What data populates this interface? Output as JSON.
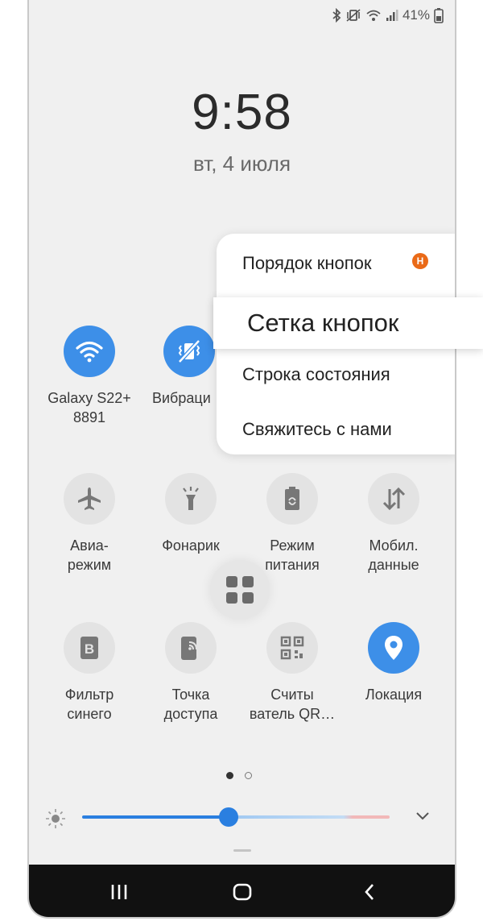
{
  "status_bar": {
    "battery_percent": "41%",
    "icons": [
      "bluetooth-icon",
      "vibrate-icon",
      "wifi-icon",
      "signal-icon",
      "battery-icon"
    ]
  },
  "lockscreen": {
    "time": "9:58",
    "date": "вт, 4 июля"
  },
  "quick_panel": {
    "row1": [
      {
        "label": "Galaxy S22+\n8891",
        "icon": "wifi-icon",
        "active": true
      },
      {
        "label": "Вибраци",
        "icon": "vibrate-icon",
        "active": true
      }
    ],
    "row2": [
      {
        "label": "Авиа-\nрежим",
        "icon": "airplane-icon",
        "active": false
      },
      {
        "label": "Фонарик",
        "icon": "flashlight-icon",
        "active": false
      },
      {
        "label": "Режим\nпитания",
        "icon": "battery-saver-icon",
        "active": false
      },
      {
        "label": "Мобил.\nданные",
        "icon": "mobile-data-icon",
        "active": false
      }
    ],
    "row3": [
      {
        "label": "Фильтр\nсинего",
        "icon": "blue-light-filter-icon",
        "active": false
      },
      {
        "label": "Точка\nдоступа",
        "icon": "hotspot-icon",
        "active": false
      },
      {
        "label": "Считы\nватель QR…",
        "icon": "qr-scanner-icon",
        "active": false
      },
      {
        "label": "Локация",
        "icon": "location-icon",
        "active": true
      }
    ],
    "page_indicator": {
      "current": 1,
      "total": 2
    },
    "brightness": {
      "level": 0.47
    }
  },
  "context_menu": {
    "items": [
      {
        "label": "Порядок кнопок",
        "badge": "Н"
      },
      {
        "label": "Сетка кнопок"
      },
      {
        "label": "Строка состояния"
      },
      {
        "label": "Свяжитесь с нами"
      }
    ]
  },
  "colors": {
    "accent": "#3d8fe8",
    "badge": "#ea6a17",
    "panel_bg": "#f0f0f0",
    "navbar_bg": "#111111"
  }
}
